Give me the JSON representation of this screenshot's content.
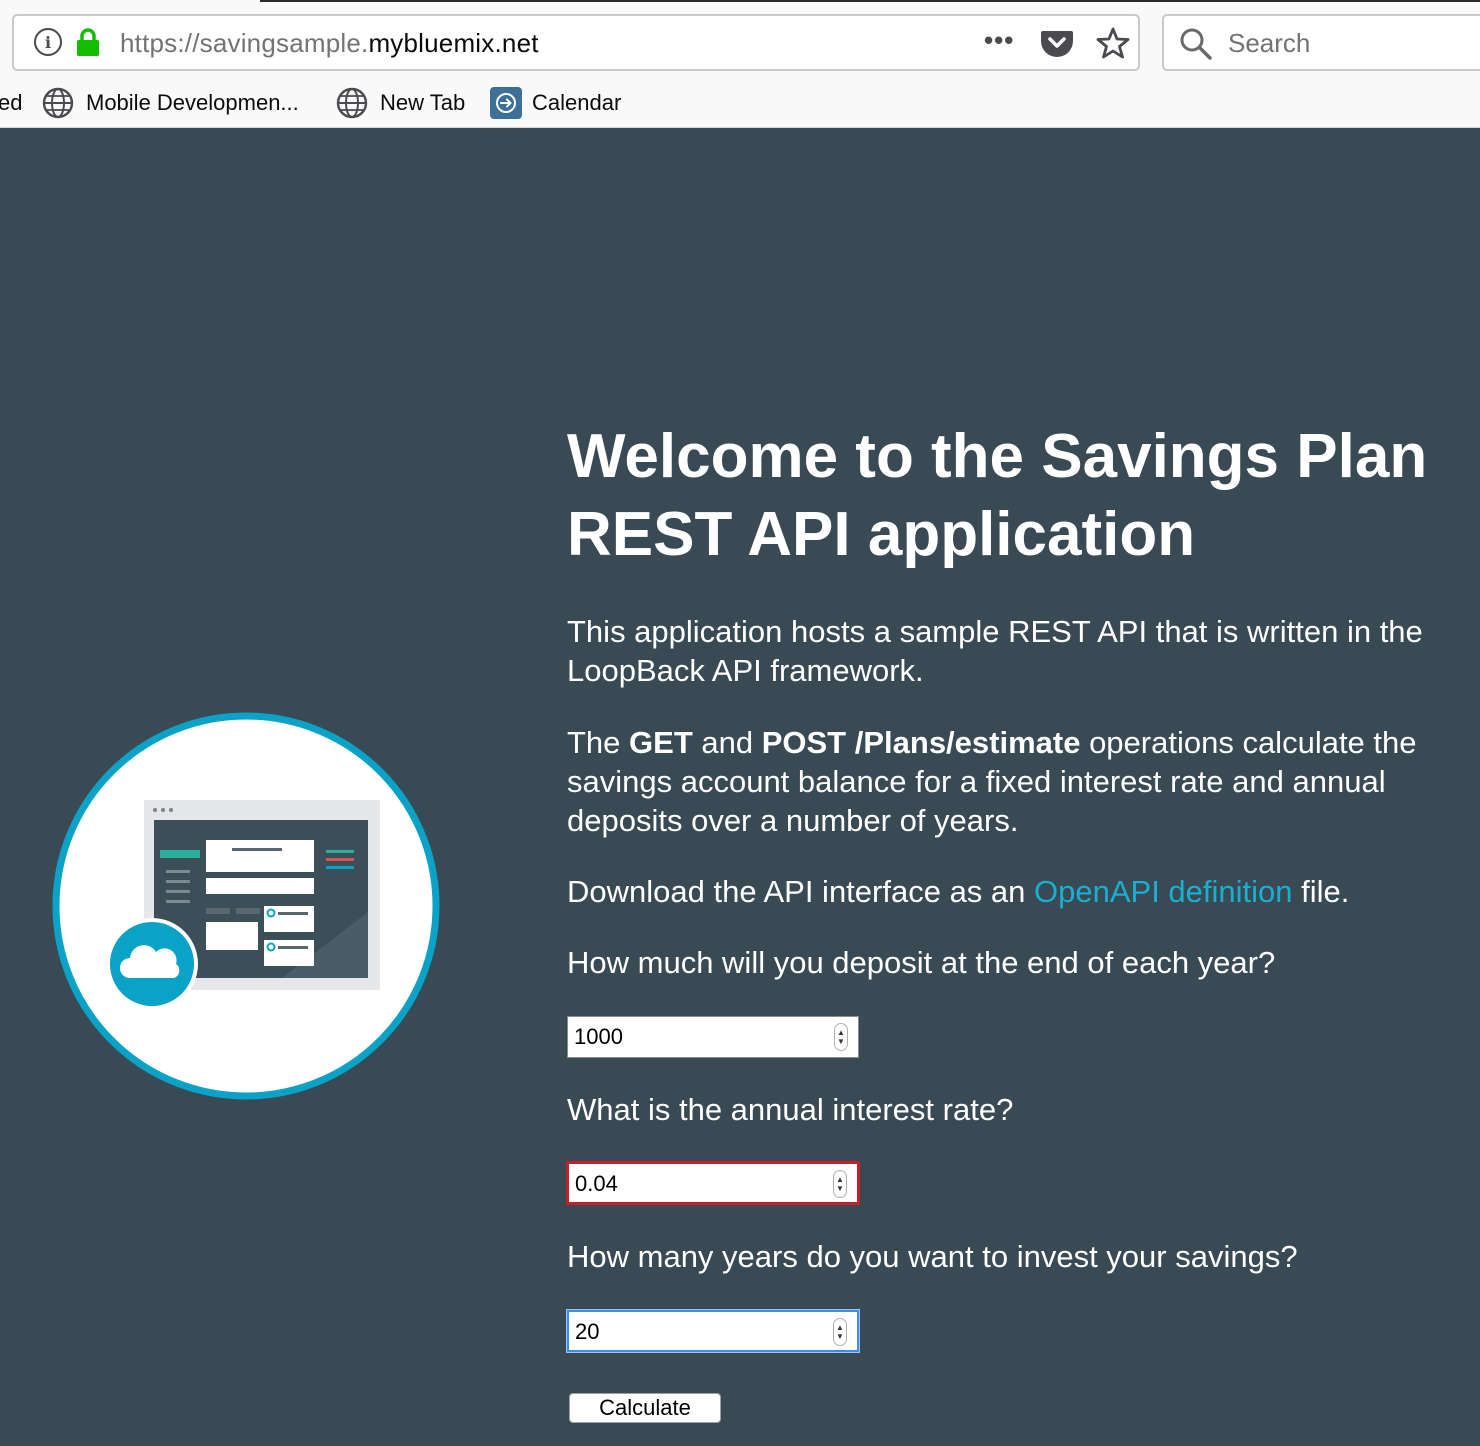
{
  "browser": {
    "url_prefix": "https://savingsample.",
    "url_domain": "mybluemix.net",
    "page_actions_label": "•••",
    "search_placeholder": "Search",
    "bookmarks": [
      {
        "label": "ed"
      },
      {
        "label": "Mobile Developmen..."
      },
      {
        "label": "New Tab"
      },
      {
        "label": "Calendar"
      }
    ]
  },
  "page": {
    "title_line1": "Welcome to the Savings Plan",
    "title_line2": "REST API application",
    "intro": "This application hosts a sample REST API that is written in the LoopBack API framework.",
    "ops_the": "The ",
    "ops_get": "GET",
    "ops_and": " and ",
    "ops_post": "POST /Plans/estimate",
    "ops_rest": " operations calculate the savings account balance for a fixed interest rate and annual deposits over a number of years.",
    "download_prefix": "Download the API interface as an ",
    "download_link": "OpenAPI definition",
    "download_suffix": " file.",
    "q_deposit": "How much will you deposit at the end of each year?",
    "deposit_value": "1000",
    "q_rate": "What is the annual interest rate?",
    "rate_value": "0.04",
    "q_years": "How many years do you want to invest your savings?",
    "years_value": "20",
    "calculate_label": "Calculate"
  },
  "colors": {
    "page_background": "#394a54",
    "link": "#1aafd0",
    "circle_ring": "#0aa3c7",
    "invalid_border": "#c4202a",
    "focus_border": "#3b8fe6"
  },
  "icons": [
    "info-icon",
    "lock-icon",
    "pocket-icon",
    "star-icon",
    "search-icon",
    "globe-icon",
    "calendar-icon",
    "cloud-icon"
  ]
}
